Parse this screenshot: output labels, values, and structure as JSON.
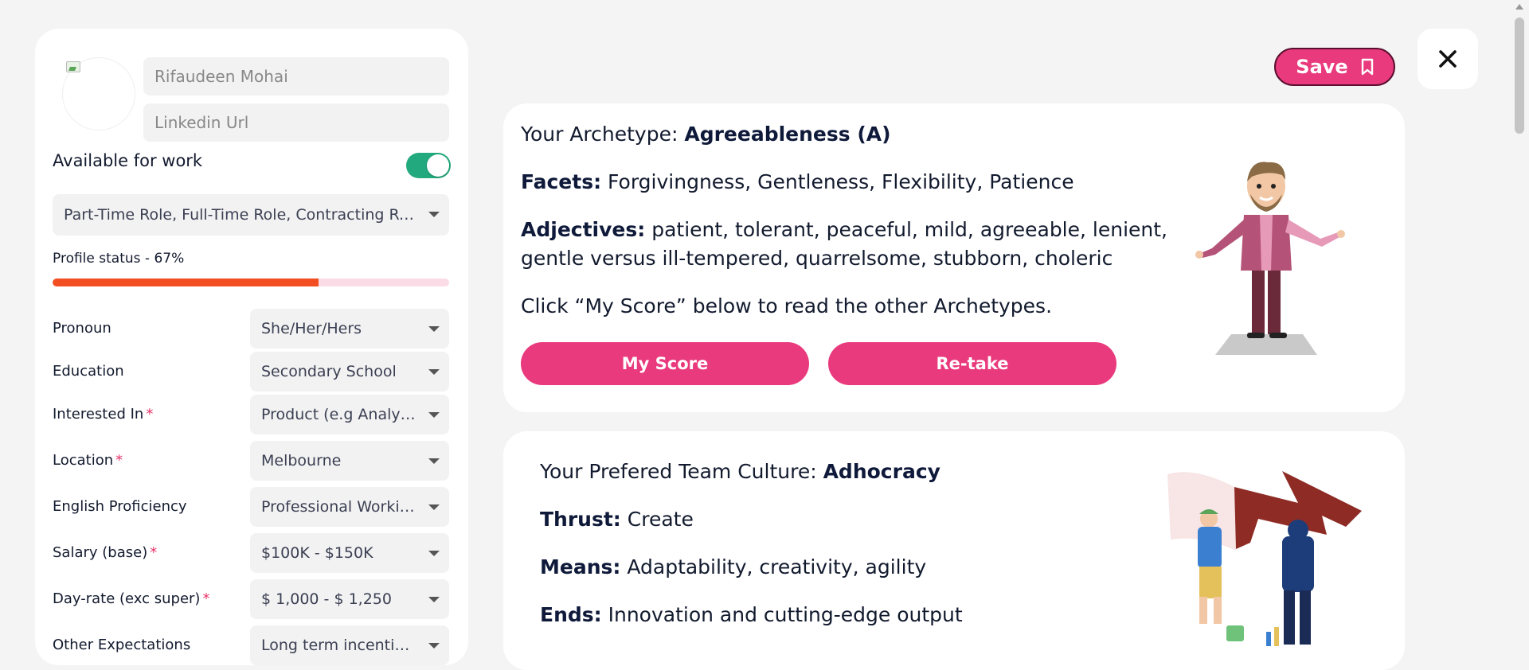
{
  "profile": {
    "name_placeholder": "Rifaudeen Mohai",
    "linkedin_placeholder": "Linkedin Url",
    "available_label": "Available for work",
    "available": true,
    "work_types": "Part-Time Role, Full-Time Role, Contracting Ro...",
    "profile_status_label": "Profile status - 67%",
    "profile_status_percent": 67
  },
  "fields": [
    {
      "label": "Pronoun",
      "required": false,
      "value": "She/Her/Hers"
    },
    {
      "label": "Education",
      "required": false,
      "value": "Secondary School"
    },
    {
      "label": "Interested In",
      "required": true,
      "value": "Product (e.g Analyst..."
    },
    {
      "label": "Location",
      "required": true,
      "value": "Melbourne"
    },
    {
      "label": "English Proficiency",
      "required": false,
      "value": "Professional Workin..."
    },
    {
      "label": "Salary (base)",
      "required": true,
      "value": "$100K - $150K"
    },
    {
      "label": "Day-rate (exc super)",
      "required": true,
      "value": "$ 1,000 - $ 1,250"
    },
    {
      "label": "Other Expectations",
      "required": false,
      "value": "Long term incentive..."
    }
  ],
  "required_mark": "*",
  "actions": {
    "save_label": "Save"
  },
  "archetype": {
    "prefix": "Your Archetype: ",
    "name": "Agreeableness (A)",
    "facets_label": "Facets:",
    "facets": "Forgivingness, Gentleness, Flexibility, Patience",
    "adjectives_label": "Adjectives:",
    "adjectives_line1": "patient, tolerant, peaceful, mild, agreeable, lenient,",
    "adjectives_line2": "gentle versus ill-tempered, quarrelsome, stubborn, choleric",
    "hint": "Click “My Score” below to read the other Archetypes.",
    "my_score_label": "My Score",
    "retake_label": "Re-take"
  },
  "culture": {
    "prefix": "Your Prefered Team Culture: ",
    "name": "Adhocracy",
    "thrust_label": "Thrust:",
    "thrust": "Create",
    "means_label": "Means:",
    "means": "Adaptability, creativity, agility",
    "ends_label": "Ends:",
    "ends": "Innovation and cutting-edge output"
  },
  "colors": {
    "accent_pink": "#e93a7d",
    "toggle_green": "#22a97d",
    "progress_orange": "#f24e22"
  }
}
